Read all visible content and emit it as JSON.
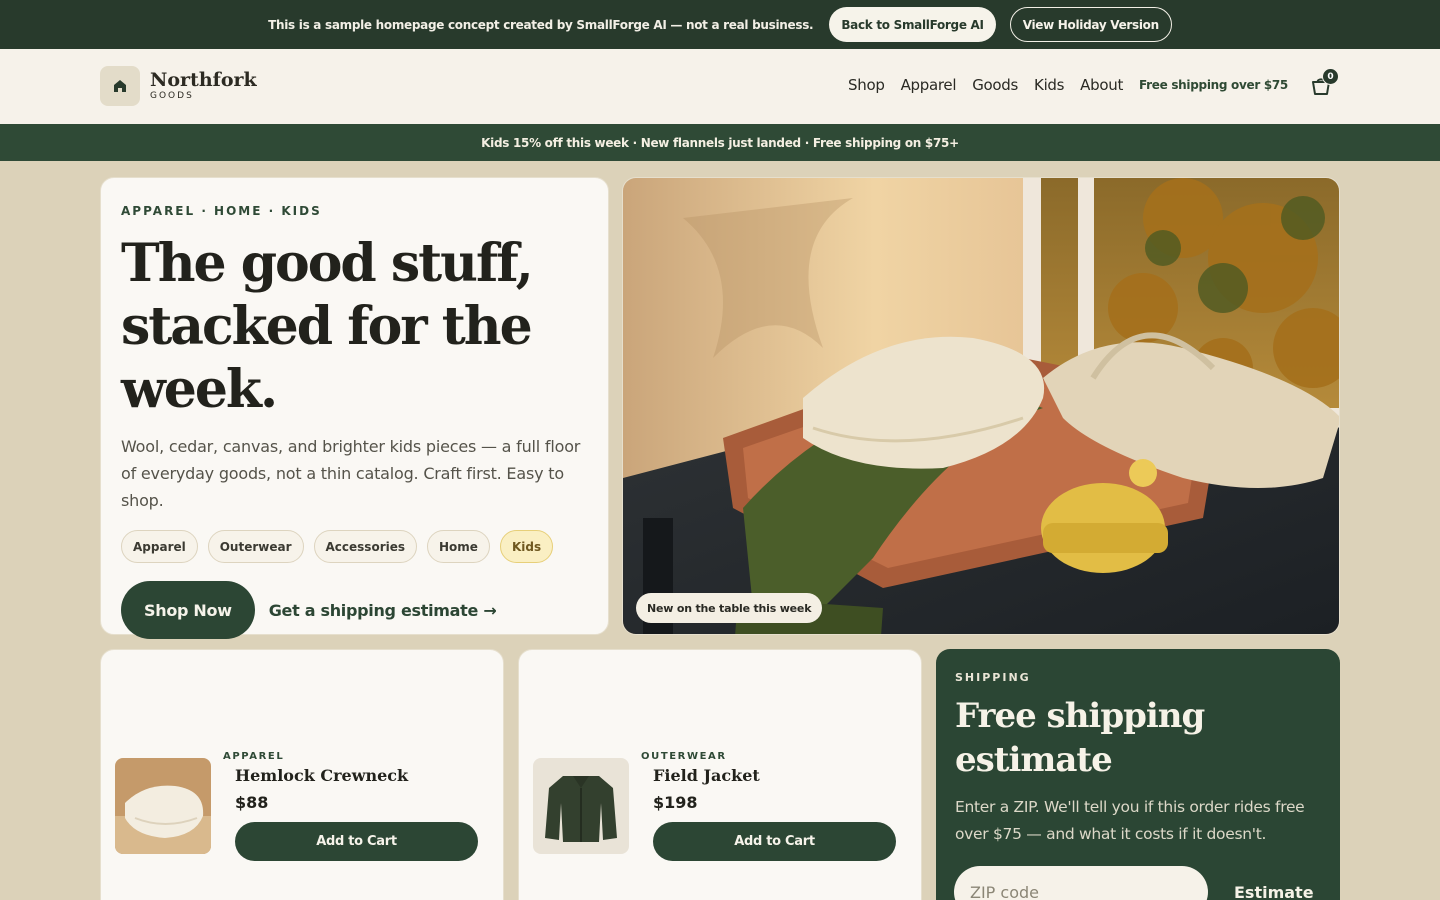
{
  "notice": {
    "text": "This is a sample homepage concept created by SmallForge AI — not a real business.",
    "back_label": "Back to SmallForge AI",
    "holiday_label": "View Holiday Version"
  },
  "header": {
    "brand_name": "Northfork",
    "brand_sub": "GOODS",
    "nav": [
      "Shop",
      "Apparel",
      "Goods",
      "Kids",
      "About"
    ],
    "shipping_note": "Free shipping over $75",
    "cart_count": "0"
  },
  "promo": {
    "text": "Kids 15% off this week · New flannels just landed · Free shipping on $75+"
  },
  "hero": {
    "eyebrow": "APPAREL · HOME · KIDS",
    "title_line1": "The good stuff,",
    "title_line2": "stacked for the",
    "title_line3": "week.",
    "description": "Wool, cedar, canvas, and brighter kids pieces — a full floor of everyday goods, not a thin catalog. Craft first. Easy to shop.",
    "chips": [
      "Apparel",
      "Outerwear",
      "Accessories",
      "Home",
      "Kids"
    ],
    "shop_now": "Shop Now",
    "estimate_link": "Get a shipping estimate →",
    "image_badge": "New on the table this week"
  },
  "products": [
    {
      "category": "APPAREL",
      "name": "Hemlock Crewneck",
      "price": "$88",
      "cta": "Add to Cart"
    },
    {
      "category": "OUTERWEAR",
      "name": "Field Jacket",
      "price": "$198",
      "cta": "Add to Cart"
    }
  ],
  "shipping": {
    "eyebrow": "SHIPPING",
    "title_line1": "Free shipping",
    "title_line2": "estimate",
    "description": "Enter a ZIP. We'll tell you if this order rides free over $75 — and what it costs if it doesn't.",
    "zip_placeholder": "ZIP code",
    "estimate_label": "Estimate"
  },
  "colors": {
    "forest": "#283a2c",
    "cream": "#f6f2ea",
    "sand": "#dcd2b9",
    "kids_chip": "#faefc3"
  },
  "icons": [
    "home-icon",
    "cart-icon"
  ]
}
